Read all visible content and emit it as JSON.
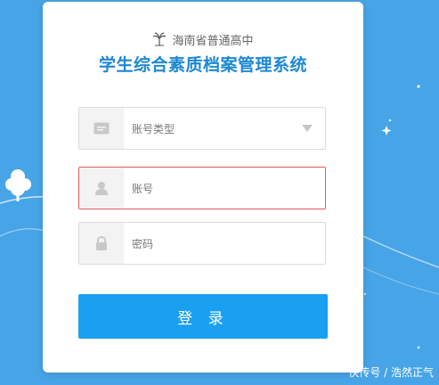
{
  "header": {
    "school_name": "海南省普通高中",
    "system_title": "学生综合素质档案管理系统"
  },
  "form": {
    "account_type": {
      "label": "账号类型",
      "icon": "id-card-icon"
    },
    "account": {
      "placeholder": "账号",
      "icon": "user-icon",
      "state": "error"
    },
    "password": {
      "placeholder": "密码",
      "icon": "lock-icon"
    },
    "login_label": "登 录"
  },
  "watermark": "快传号 / 浩然正气",
  "colors": {
    "background": "#47a4e6",
    "title": "#1e88d2",
    "button": "#1aa0f0",
    "error_border": "#e25b5b"
  }
}
